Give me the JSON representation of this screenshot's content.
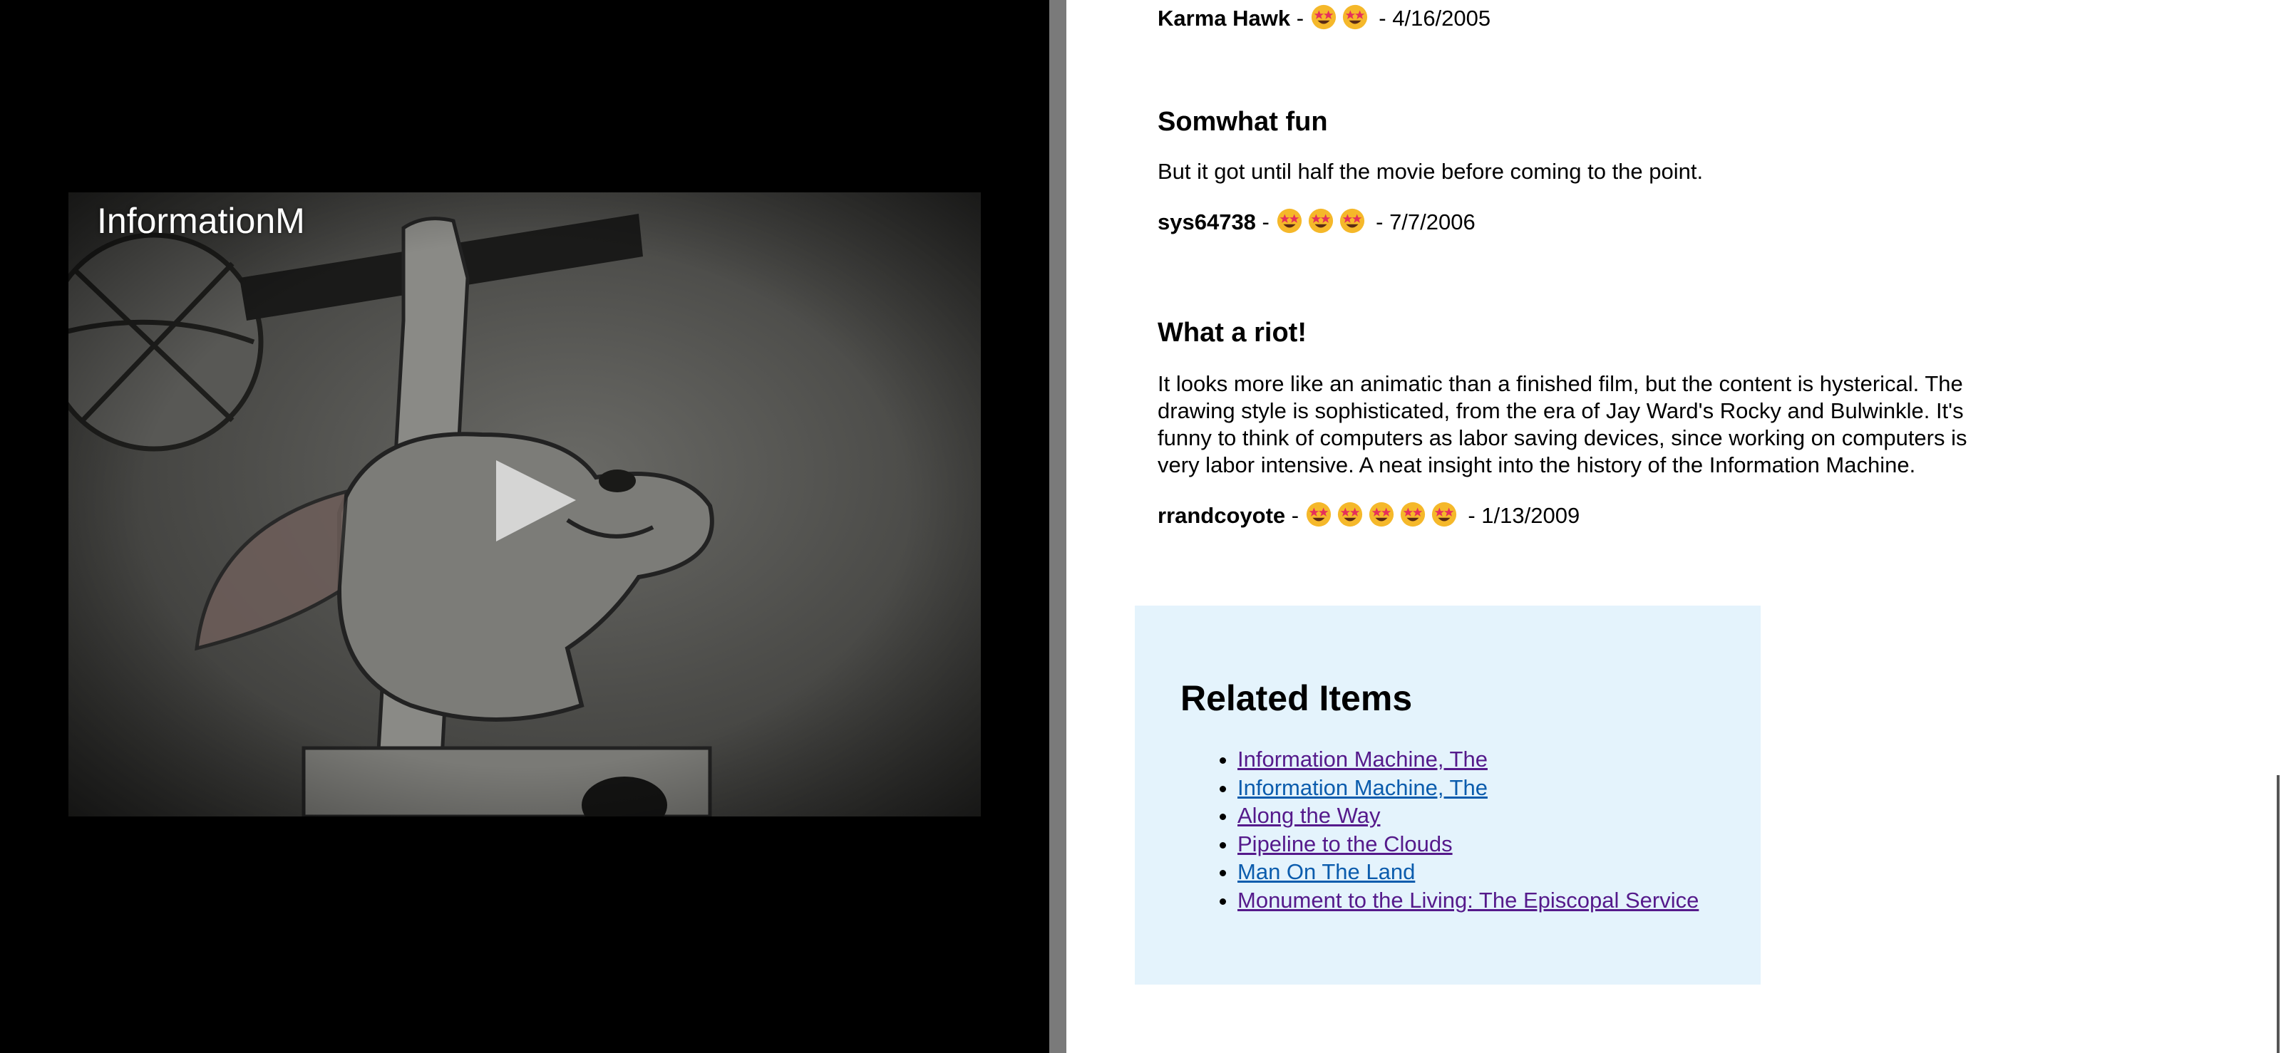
{
  "video": {
    "title": "InformationM"
  },
  "reviews": [
    {
      "title": "",
      "body": "",
      "reviewer": "Karma Hawk",
      "stars": 2,
      "date": "4/16/2005"
    },
    {
      "title": "Somwhat fun",
      "body": "But it got until half the movie before coming to the point.",
      "reviewer": "sys64738",
      "stars": 3,
      "date": "7/7/2006"
    },
    {
      "title": "What a riot!",
      "body": "It looks more like an animatic than a finished film, but the content is hysterical. The drawing style is sophisticated, from the era of Jay Ward's Rocky and Bulwinkle. It's funny to think of computers as labor saving devices, since working on computers is very labor intensive. A neat insight into the history of the Information Machine.",
      "reviewer": "rrandcoyote",
      "stars": 5,
      "date": "1/13/2009"
    }
  ],
  "separator": " - ",
  "star_icon": "star-struck-emoji-icon",
  "related": {
    "title": "Related Items",
    "items": [
      {
        "label": "Information Machine, The",
        "visited": true
      },
      {
        "label": "Information Machine, The",
        "visited": false
      },
      {
        "label": "Along the Way",
        "visited": true
      },
      {
        "label": "Pipeline to the Clouds",
        "visited": true
      },
      {
        "label": "Man On The Land",
        "visited": false
      },
      {
        "label": "Monument to the Living: The Episcopal Service",
        "visited": true
      }
    ]
  },
  "colors": {
    "related_bg": "#e4f3fc",
    "link_visited": "#551a8b",
    "link_normal": "#0b5cad",
    "emoji_face": "#f5b82a",
    "emoji_eyes": "#e6305a"
  }
}
